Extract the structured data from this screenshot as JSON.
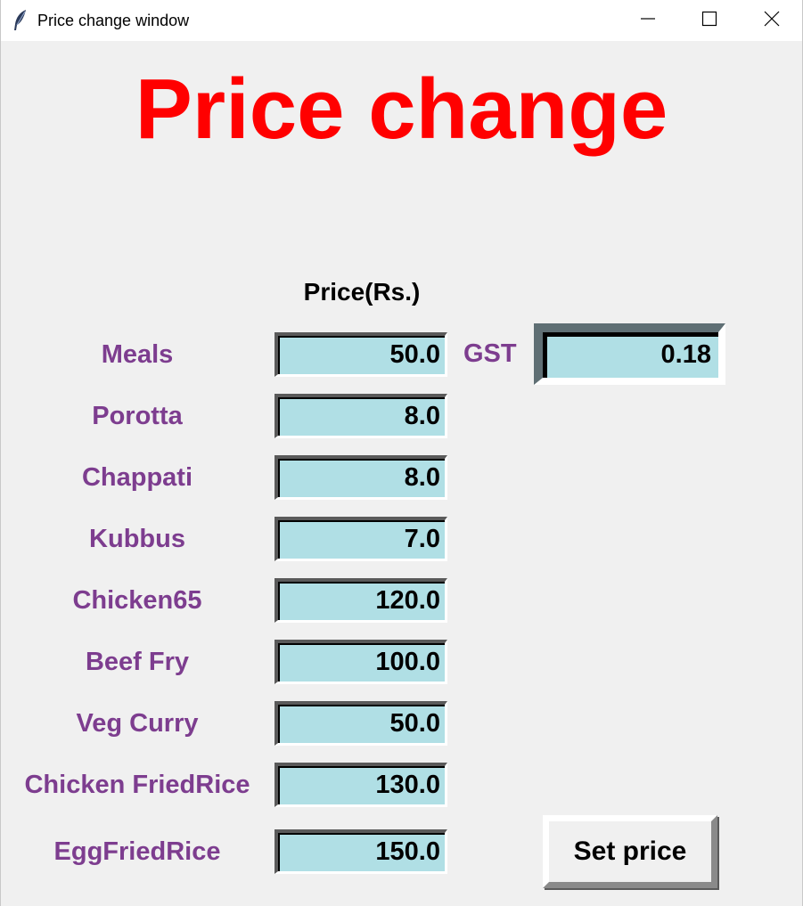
{
  "window": {
    "title": "Price change window",
    "icon": "feather-icon",
    "controls": [
      "minimize-icon",
      "maximize-icon",
      "close-icon"
    ]
  },
  "heading": "Price change",
  "price_header": "Price(Rs.)",
  "items": [
    {
      "label": "Meals",
      "price": "50.0"
    },
    {
      "label": "Porotta",
      "price": "8.0"
    },
    {
      "label": "Chappati",
      "price": "8.0"
    },
    {
      "label": "Kubbus",
      "price": "7.0"
    },
    {
      "label": "Chicken65",
      "price": "120.0"
    },
    {
      "label": "Beef Fry",
      "price": "100.0"
    },
    {
      "label": "Veg Curry",
      "price": "50.0"
    },
    {
      "label": "Chicken FriedRice",
      "price": "130.0"
    },
    {
      "label": "EggFriedRice",
      "price": "150.0"
    }
  ],
  "gst": {
    "label": "GST",
    "value": "0.18"
  },
  "set_price_button": "Set price",
  "colors": {
    "heading": "#ff0000",
    "label": "#7d3d8f",
    "entry_background": "#b0dfe5",
    "window_background": "#f0f0f0"
  }
}
